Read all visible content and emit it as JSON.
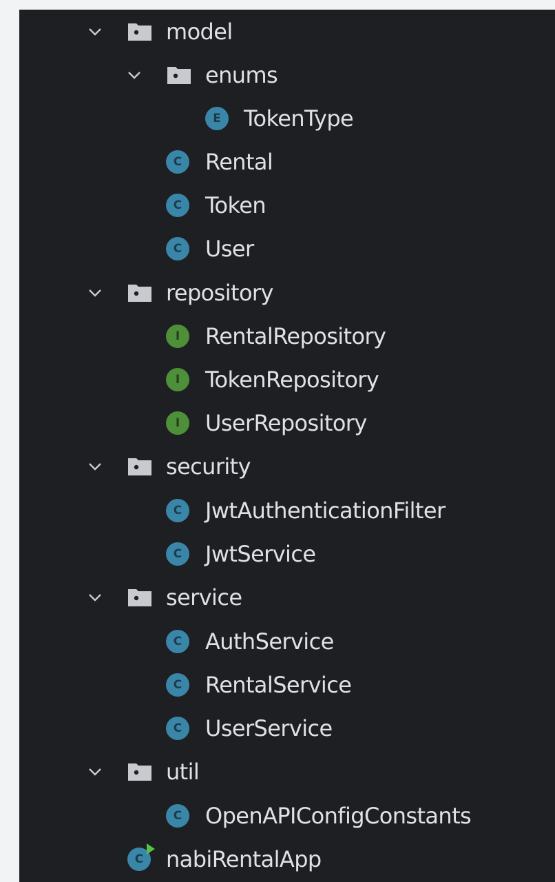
{
  "tree": {
    "nodes": [
      {
        "label": "model",
        "kind": "folder",
        "expanded": true,
        "depth": 0
      },
      {
        "label": "enums",
        "kind": "folder",
        "expanded": true,
        "depth": 1
      },
      {
        "label": "TokenType",
        "kind": "enum",
        "icon_letter": "E",
        "depth": 2
      },
      {
        "label": "Rental",
        "kind": "class",
        "icon_letter": "C",
        "depth": 1
      },
      {
        "label": "Token",
        "kind": "class",
        "icon_letter": "C",
        "depth": 1
      },
      {
        "label": "User",
        "kind": "class",
        "icon_letter": "C",
        "depth": 1
      },
      {
        "label": "repository",
        "kind": "folder",
        "expanded": true,
        "depth": 0
      },
      {
        "label": "RentalRepository",
        "kind": "interface",
        "icon_letter": "I",
        "depth": 1
      },
      {
        "label": "TokenRepository",
        "kind": "interface",
        "icon_letter": "I",
        "depth": 1
      },
      {
        "label": "UserRepository",
        "kind": "interface",
        "icon_letter": "I",
        "depth": 1
      },
      {
        "label": "security",
        "kind": "folder",
        "expanded": true,
        "depth": 0
      },
      {
        "label": "JwtAuthenticationFilter",
        "kind": "class",
        "icon_letter": "C",
        "depth": 1
      },
      {
        "label": "JwtService",
        "kind": "class",
        "icon_letter": "C",
        "depth": 1
      },
      {
        "label": "service",
        "kind": "folder",
        "expanded": true,
        "depth": 0
      },
      {
        "label": "AuthService",
        "kind": "class",
        "icon_letter": "C",
        "depth": 1
      },
      {
        "label": "RentalService",
        "kind": "class",
        "icon_letter": "C",
        "depth": 1
      },
      {
        "label": "UserService",
        "kind": "class",
        "icon_letter": "C",
        "depth": 1
      },
      {
        "label": "util",
        "kind": "folder",
        "expanded": true,
        "depth": 0
      },
      {
        "label": "OpenAPIConfigConstants",
        "kind": "class",
        "icon_letter": "C",
        "depth": 1
      },
      {
        "label": "nabiRentalApp",
        "kind": "application",
        "icon_letter": "C",
        "depth": 0
      }
    ]
  },
  "colors": {
    "panel_background": "#1e1f22",
    "text": "#dfe1e5",
    "class_icon": "#3a86a8",
    "interface_icon": "#4e8f39",
    "run_marker": "#57c144"
  },
  "icons": {
    "folder": "package-folder-icon",
    "expand": "chevron-down-icon",
    "class": "class-icon",
    "enum": "enum-icon",
    "interface": "interface-icon",
    "application": "spring-app-class-icon"
  }
}
